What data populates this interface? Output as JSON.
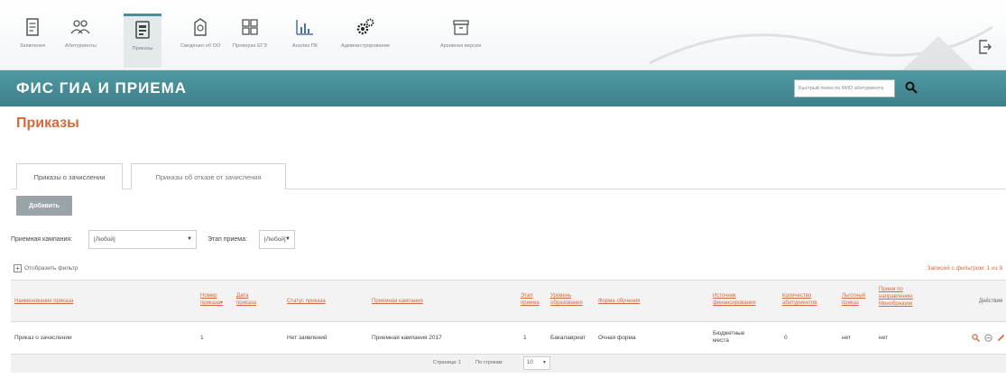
{
  "toolbar": {
    "items": [
      {
        "label": "Заявления",
        "icon": "document-icon"
      },
      {
        "label": "Абитуриенты",
        "icon": "people-icon"
      },
      {
        "label": "Приказы",
        "icon": "orders-icon",
        "active": true
      },
      {
        "label": "Сведения об ОО",
        "icon": "building-info-icon"
      },
      {
        "label": "Проверка ЕГЭ",
        "icon": "grid-check-icon"
      },
      {
        "label": "Анализ ПК",
        "icon": "chart-icon"
      },
      {
        "label": "Администрирование",
        "icon": "gears-icon"
      },
      {
        "label": "Архивная версия",
        "icon": "archive-icon"
      }
    ]
  },
  "header": {
    "app_title": "ФИС ГИА И ПРИЕМА",
    "search_placeholder": "Быстрый поиск по ФИО абитуриента"
  },
  "page": {
    "title": "Приказы",
    "tabs": [
      "Приказы о зачислении",
      "Приказы об отказе от зачисления"
    ],
    "add_label": "Добавить"
  },
  "filters": {
    "campaign_label": "Приемная кампания:",
    "campaign_value": "[Любой]",
    "stage_label": "Этап приема:",
    "stage_value": "[Любой]",
    "toggle_label": "Отобразить фильтр",
    "records_text": "Записей с фильтром: 1 из 9"
  },
  "table": {
    "headers": [
      "Наименование приказа",
      "Номер приказа▾",
      "Дата приказа",
      "Статус приказа",
      "Приемная кампания",
      "Этап приема",
      "Уровень образования",
      "Форма обучения",
      "Источник финансирования",
      "Количество абитуриентов",
      "Льготный приказ",
      "Прием по направлению Минобрнауки",
      "Действия"
    ],
    "rows": [
      {
        "name": "Приказ о зачислении",
        "number": "1",
        "date": "",
        "status": "Нет заявлений",
        "campaign": "Приемная кампания 2017",
        "stage": "1",
        "level": "Бакалавриат",
        "form": "Очная форма",
        "finance": "Бюджетные места",
        "count": "0",
        "privileged": "нет",
        "ministry": "нет"
      }
    ]
  },
  "pager": {
    "page_text": "Страница: 1",
    "per_page_label": "По строкам:",
    "per_page_value": "10"
  },
  "colors": {
    "accent": "#4a8f98",
    "link": "#d2693e"
  }
}
